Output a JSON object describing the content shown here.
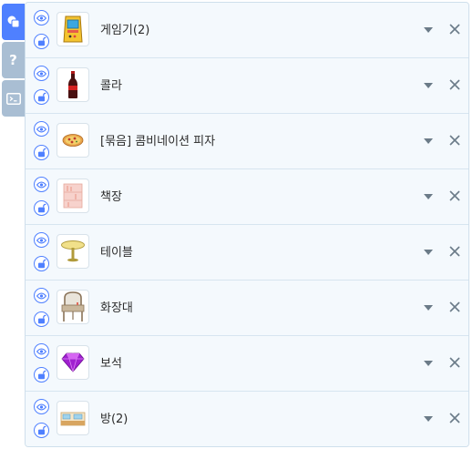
{
  "side_tabs": [
    {
      "icon": "objects-icon",
      "active": true
    },
    {
      "icon": "help-icon",
      "label": "?",
      "active": false
    },
    {
      "icon": "console-icon",
      "active": false
    }
  ],
  "objects": [
    {
      "name": "게임기(2)",
      "icon": "arcade-machine-icon"
    },
    {
      "name": "콜라",
      "icon": "cola-bottle-icon"
    },
    {
      "name": "[묶음] 콤비네이션 피자",
      "icon": "pizza-icon"
    },
    {
      "name": "책장",
      "icon": "bookshelf-icon"
    },
    {
      "name": "테이블",
      "icon": "round-table-icon"
    },
    {
      "name": "화장대",
      "icon": "dresser-icon"
    },
    {
      "name": "보석",
      "icon": "gem-icon"
    },
    {
      "name": "방(2)",
      "icon": "room-icon"
    }
  ],
  "colors": {
    "accent": "#4f80ff",
    "tab_inactive": "#a9bed3",
    "panel_bg": "#f4f9fd",
    "row_border": "#d7e5f0",
    "control_gray": "#6b7b88"
  }
}
